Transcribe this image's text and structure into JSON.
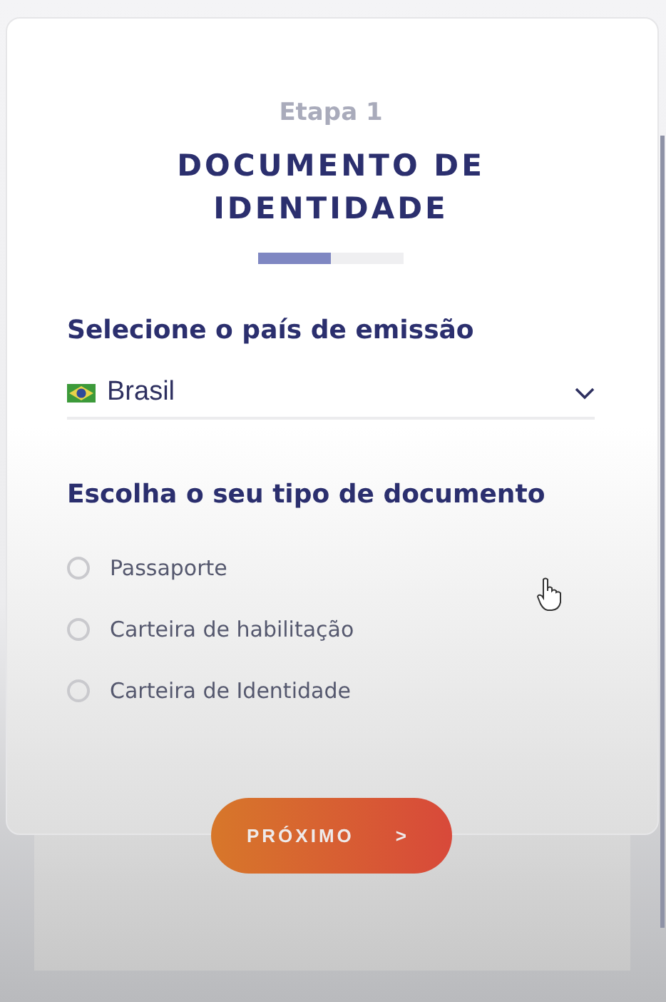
{
  "step_label": "Etapa 1",
  "title": "DOCUMENTO DE IDENTIDADE",
  "progress": {
    "level": 0.5
  },
  "country_section": {
    "heading": "Selecione o país de emissão",
    "select": {
      "value": "Brasil"
    }
  },
  "document_section": {
    "heading": "Escolha o seu tipo de documento",
    "options": [
      {
        "label": "Passaporte",
        "selected": false
      },
      {
        "label": "Carteira de habilitação",
        "selected": false
      },
      {
        "label": "Carteira de Identidade",
        "selected": false
      }
    ]
  },
  "next_button": {
    "label": "PRÓXIMO",
    "arrow": ">"
  }
}
